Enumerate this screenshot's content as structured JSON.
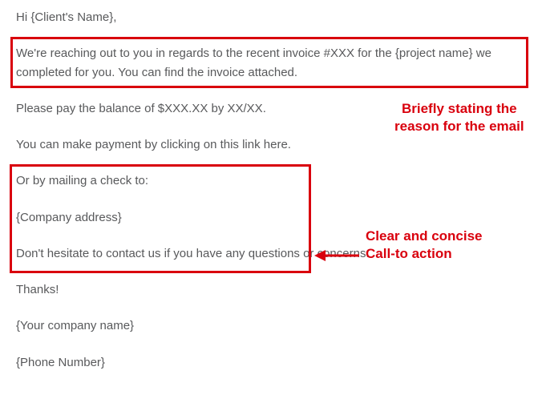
{
  "email": {
    "greeting": "Hi {Client's Name},",
    "para_invoice": "We're reaching out to you in regards to the recent invoice #XXX for the {project name} we completed for you. You can find the invoice attached.",
    "para_balance": "Please pay the balance of $XXX.XX by XX/XX.",
    "para_payment_link": "You can make payment by clicking on this link here.",
    "para_mail_check": "Or by mailing a check to:",
    "para_company_address": "{Company address}",
    "para_contact": "Don't hesitate to contact us if you have any questions or concerns.",
    "para_thanks": "Thanks!",
    "para_company_name": "{Your company name}",
    "para_phone": "{Phone Number}"
  },
  "annotations": {
    "reason_line1": "Briefly stating the",
    "reason_line2": "reason for the email",
    "cta_line1": "Clear and concise",
    "cta_line2": "Call-to action"
  },
  "colors": {
    "highlight": "#d9000d",
    "text": "#58595b"
  }
}
